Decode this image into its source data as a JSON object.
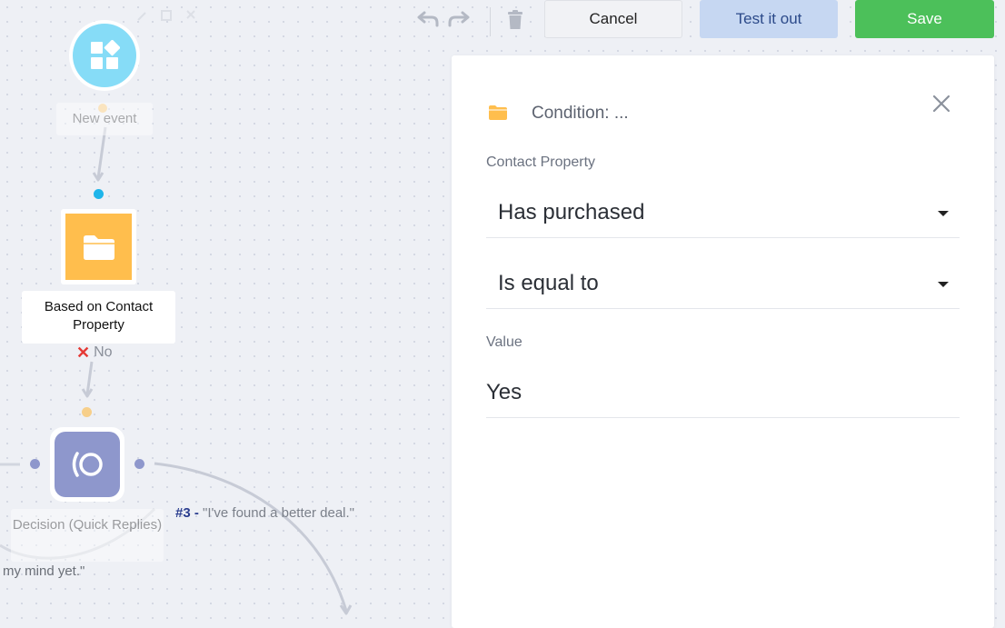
{
  "toolbar": {
    "cancel_label": "Cancel",
    "test_label": "Test it out",
    "save_label": "Save"
  },
  "canvas": {
    "new_event_label": "New event",
    "condition_node_label": "Based on Contact Property",
    "no_branch_label": "No",
    "decision_node_label": "Decision (Quick Replies)",
    "reply3_number": "#3 -",
    "reply3_text": "\"I've found a better deal.\"",
    "reply_partial_text": "my mind yet.\""
  },
  "panel": {
    "title": "Condition: ...",
    "contact_property_label": "Contact Property",
    "property_value": "Has purchased",
    "operator_value": "Is equal to",
    "value_label": "Value",
    "value": "Yes"
  },
  "colors": {
    "save_green": "#4cc05a",
    "test_blue": "#c6d7f2",
    "event_cyan": "#86dcf7",
    "condition_yellow": "#ffbe4d",
    "decision_purple": "#8e97cc",
    "no_red": "#e53935",
    "link_blue": "#2a3d8f"
  }
}
